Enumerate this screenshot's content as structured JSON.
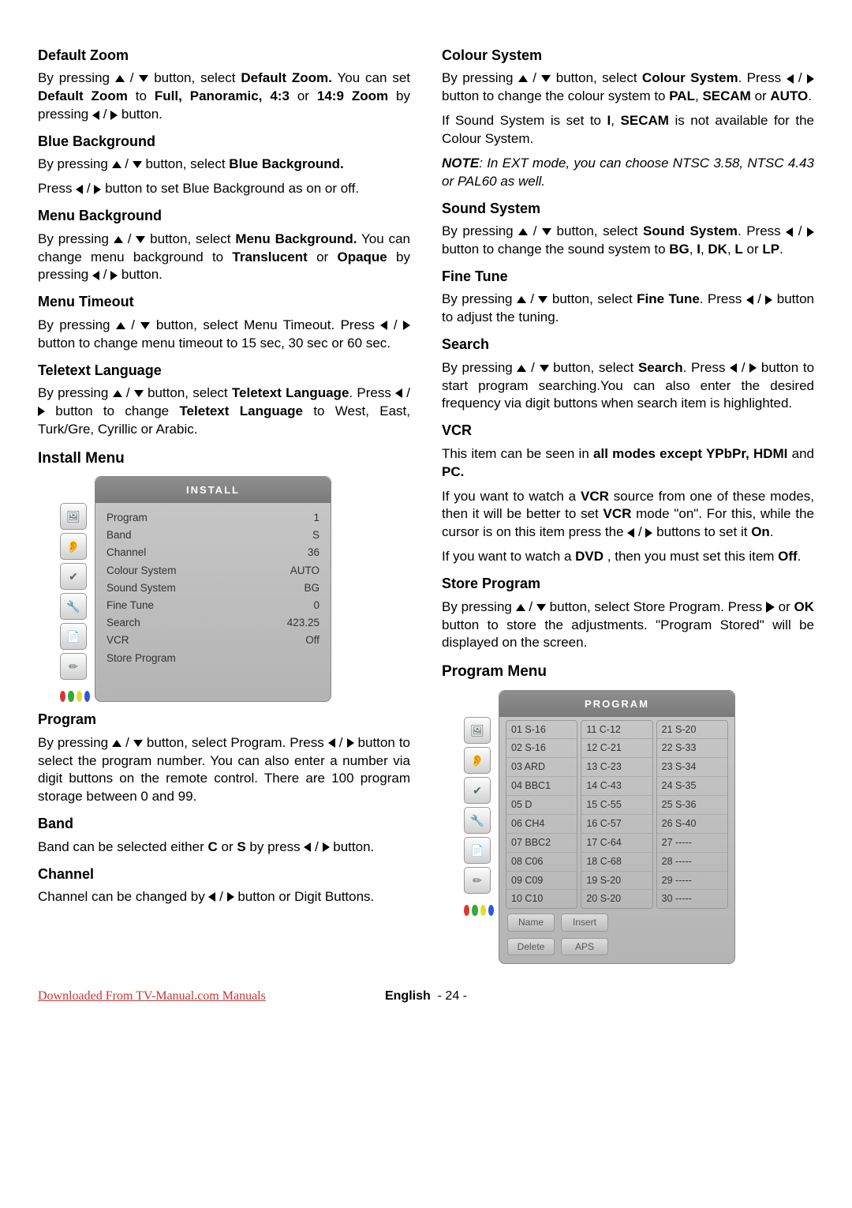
{
  "footer": {
    "download_text": "Downloaded From TV-Manual.com Manuals",
    "lang": "English",
    "page": "- 24 -"
  },
  "left": {
    "sections": [
      {
        "heading": "Default Zoom",
        "paras": [
          {
            "parts": [
              {
                "t": "By pressing "
              },
              {
                "arrow": "up"
              },
              {
                "t": " / "
              },
              {
                "arrow": "down"
              },
              {
                "t": " button, select "
              },
              {
                "t": "Default Zoom.",
                "b": true
              },
              {
                "t": " You can set "
              },
              {
                "t": "Default Zoom",
                "b": true
              },
              {
                "t": " to "
              },
              {
                "t": "Full, Panoramic, 4:3",
                "b": true
              },
              {
                "t": " or "
              },
              {
                "t": "14:9 Zoom",
                "b": true
              },
              {
                "t": " by pressing "
              },
              {
                "arrow": "left"
              },
              {
                "t": " / "
              },
              {
                "arrow": "right"
              },
              {
                "t": " button."
              }
            ]
          }
        ]
      },
      {
        "heading": "Blue Background",
        "paras": [
          {
            "parts": [
              {
                "t": "By pressing "
              },
              {
                "arrow": "up"
              },
              {
                "t": " / "
              },
              {
                "arrow": "down"
              },
              {
                "t": " button, select "
              },
              {
                "t": "Blue Background.",
                "b": true
              }
            ]
          },
          {
            "parts": [
              {
                "t": "Press "
              },
              {
                "arrow": "left"
              },
              {
                "t": " / "
              },
              {
                "arrow": "right"
              },
              {
                "t": " button  to set Blue Background as on or off."
              }
            ]
          }
        ]
      },
      {
        "heading": "Menu Background",
        "paras": [
          {
            "parts": [
              {
                "t": "By pressing "
              },
              {
                "arrow": "up"
              },
              {
                "t": " / "
              },
              {
                "arrow": "down"
              },
              {
                "t": " button, select "
              },
              {
                "t": "Menu Background.",
                "b": true
              },
              {
                "t": " You can change menu background to "
              },
              {
                "t": "Translucent",
                "b": true
              },
              {
                "t": " or "
              },
              {
                "t": "Opaque",
                "b": true
              },
              {
                "t": " by pressing "
              },
              {
                "arrow": "left"
              },
              {
                "t": " / "
              },
              {
                "arrow": "right"
              },
              {
                "t": " button."
              }
            ]
          }
        ]
      },
      {
        "heading": "Menu Timeout",
        "paras": [
          {
            "parts": [
              {
                "t": "By pressing "
              },
              {
                "arrow": "up"
              },
              {
                "t": " / "
              },
              {
                "arrow": "down"
              },
              {
                "t": "  button, select Menu Timeout. Press "
              },
              {
                "arrow": "left"
              },
              {
                "t": " / "
              },
              {
                "arrow": "right"
              },
              {
                "t": " button to change menu timeout to 15 sec, 30 sec or 60 sec."
              }
            ]
          }
        ]
      },
      {
        "heading": "Teletext Language",
        "paras": [
          {
            "parts": [
              {
                "t": "By pressing "
              },
              {
                "arrow": "up"
              },
              {
                "t": " / "
              },
              {
                "arrow": "down"
              },
              {
                "t": " button, select "
              },
              {
                "t": "Teletext Language",
                "b": true
              },
              {
                "t": ". Press "
              },
              {
                "arrow": "left"
              },
              {
                "t": " / "
              },
              {
                "arrow": "right"
              },
              {
                "t": " button to change "
              },
              {
                "t": "Teletext Language",
                "b": true
              },
              {
                "t": " to West, East, Turk/Gre, Cyrillic or Arabic."
              }
            ]
          }
        ]
      }
    ],
    "big_heading": "Install Menu",
    "install_menu": {
      "title": "INSTALL",
      "rows": [
        {
          "label": "Program",
          "value": "1"
        },
        {
          "label": "Band",
          "value": "S"
        },
        {
          "label": "Channel",
          "value": "36"
        },
        {
          "label": "Colour System",
          "value": "AUTO"
        },
        {
          "label": "Sound System",
          "value": "BG"
        },
        {
          "label": "Fine Tune",
          "value": "0"
        },
        {
          "label": "Search",
          "value": "423.25"
        },
        {
          "label": "VCR",
          "value": "Off"
        },
        {
          "label": "Store Program",
          "value": ""
        }
      ]
    },
    "after_menu": [
      {
        "heading": "Program",
        "paras": [
          {
            "parts": [
              {
                "t": "By pressing "
              },
              {
                "arrow": "up"
              },
              {
                "t": " / "
              },
              {
                "arrow": "down"
              },
              {
                "t": "  button, select Program. Press "
              },
              {
                "arrow": "left"
              },
              {
                "t": " / "
              },
              {
                "arrow": "right"
              },
              {
                "t": " button to select the program number. You can also enter a number via digit buttons on the remote control. There are 100 program storage between 0 and 99."
              }
            ]
          }
        ]
      },
      {
        "heading": "Band",
        "paras": [
          {
            "parts": [
              {
                "t": "Band can be selected either "
              },
              {
                "t": "C",
                "b": true
              },
              {
                "t": " or "
              },
              {
                "t": "S",
                "b": true
              },
              {
                "t": " by press "
              },
              {
                "arrow": "left"
              },
              {
                "t": " / "
              },
              {
                "arrow": "right"
              },
              {
                "t": " button."
              }
            ]
          }
        ]
      },
      {
        "heading": "Channel",
        "paras": [
          {
            "parts": [
              {
                "t": "Channel can be changed by "
              },
              {
                "arrow": "left"
              },
              {
                "t": " / "
              },
              {
                "arrow": "right"
              },
              {
                "t": " button or Digit Buttons."
              }
            ]
          }
        ]
      }
    ]
  },
  "right": {
    "sections": [
      {
        "heading": "Colour System",
        "paras": [
          {
            "parts": [
              {
                "t": "By pressing "
              },
              {
                "arrow": "up"
              },
              {
                "t": " / "
              },
              {
                "arrow": "down"
              },
              {
                "t": " button, select "
              },
              {
                "t": "Colour System",
                "b": true
              },
              {
                "t": ". Press "
              },
              {
                "arrow": "left"
              },
              {
                "t": " / "
              },
              {
                "arrow": "right"
              },
              {
                "t": " button to change the colour system to "
              },
              {
                "t": "PAL",
                "b": true
              },
              {
                "t": ", "
              },
              {
                "t": "SECAM",
                "b": true
              },
              {
                "t": " or "
              },
              {
                "t": "AUTO",
                "b": true
              },
              {
                "t": "."
              }
            ]
          },
          {
            "parts": [
              {
                "t": "If Sound  System is set to "
              },
              {
                "t": "I",
                "b": true
              },
              {
                "t": ", "
              },
              {
                "t": "SECAM",
                "b": true
              },
              {
                "t": " is not available for the Colour System."
              }
            ]
          },
          {
            "parts": [
              {
                "t": "NOTE",
                "b": true,
                "i": true
              },
              {
                "t": ": In EXT mode, you can choose NTSC 3.58, NTSC 4.43 or PAL60 as well.",
                "i": true
              }
            ]
          }
        ]
      },
      {
        "heading": "Sound System",
        "paras": [
          {
            "parts": [
              {
                "t": "By pressing "
              },
              {
                "arrow": "up"
              },
              {
                "t": " / "
              },
              {
                "arrow": "down"
              },
              {
                "t": " button, select "
              },
              {
                "t": "Sound System",
                "b": true
              },
              {
                "t": ". Press "
              },
              {
                "arrow": "left"
              },
              {
                "t": " / "
              },
              {
                "arrow": "right"
              },
              {
                "t": " button to change the sound system to "
              },
              {
                "t": "BG",
                "b": true
              },
              {
                "t": ", "
              },
              {
                "t": "I",
                "b": true
              },
              {
                "t": ", "
              },
              {
                "t": "DK",
                "b": true
              },
              {
                "t": ", "
              },
              {
                "t": "L",
                "b": true
              },
              {
                "t": " or "
              },
              {
                "t": "LP",
                "b": true
              },
              {
                "t": "."
              }
            ]
          }
        ]
      },
      {
        "heading": "Fine Tune",
        "paras": [
          {
            "parts": [
              {
                "t": "By pressing "
              },
              {
                "arrow": "up"
              },
              {
                "t": " / "
              },
              {
                "arrow": "down"
              },
              {
                "t": " button, select "
              },
              {
                "t": "Fine Tune",
                "b": true
              },
              {
                "t": ". Press "
              },
              {
                "arrow": "left"
              },
              {
                "t": " / "
              },
              {
                "arrow": "right"
              },
              {
                "t": " button to adjust the tuning."
              }
            ]
          }
        ]
      },
      {
        "heading": "Search",
        "paras": [
          {
            "parts": [
              {
                "t": "By pressing "
              },
              {
                "arrow": "up"
              },
              {
                "t": " / "
              },
              {
                "arrow": "down"
              },
              {
                "t": " button, select "
              },
              {
                "t": "Search",
                "b": true
              },
              {
                "t": ". Press  "
              },
              {
                "arrow": "left"
              },
              {
                "t": " / "
              },
              {
                "arrow": "right"
              },
              {
                "t": " button to start program searching.You can also enter the desired frequency via digit buttons when search item is highlighted."
              }
            ]
          }
        ]
      },
      {
        "heading": "VCR",
        "paras": [
          {
            "parts": [
              {
                "t": "This item can be seen in "
              },
              {
                "t": "all modes except  YPbPr, HDMI",
                "b": true
              },
              {
                "t": " and "
              },
              {
                "t": "PC.",
                "b": true
              }
            ]
          },
          {
            "parts": [
              {
                "t": "If you want to watch a "
              },
              {
                "t": "VCR",
                "b": true
              },
              {
                "t": " source from one of these modes, then  it will be better to set "
              },
              {
                "t": "VCR",
                "b": true
              },
              {
                "t": " mode \"on\". For this, while the cursor is on this item press the "
              },
              {
                "arrow": "left"
              },
              {
                "t": " / "
              },
              {
                "arrow": "right"
              },
              {
                "t": " buttons to set it "
              },
              {
                "t": "On",
                "b": true
              },
              {
                "t": "."
              }
            ]
          },
          {
            "parts": [
              {
                "t": "If you want to watch a "
              },
              {
                "t": "DVD",
                "b": true
              },
              {
                "t": " , then you must set this item "
              },
              {
                "t": "Off",
                "b": true
              },
              {
                "t": "."
              }
            ]
          }
        ]
      },
      {
        "heading": "Store Program",
        "paras": [
          {
            "parts": [
              {
                "t": "By pressing "
              },
              {
                "arrow": "up"
              },
              {
                "t": " / "
              },
              {
                "arrow": "down"
              },
              {
                "t": "  button, select Store Program. Press "
              },
              {
                "arrow": "play"
              },
              {
                "t": " or "
              },
              {
                "t": "OK",
                "b": true
              },
              {
                "t": " button to store the adjustments. \"Program Stored\" will be displayed on the screen."
              }
            ]
          }
        ]
      }
    ],
    "big_heading": "Program Menu",
    "program_menu": {
      "title": "PROGRAM",
      "columns": [
        [
          "01 S-16",
          "02 S-16",
          "03 ARD",
          "04 BBC1",
          "05 D",
          "06 CH4",
          "07 BBC2",
          "08 C06",
          "09 C09",
          "10 C10"
        ],
        [
          "11 C-12",
          "12 C-21",
          "13 C-23",
          "14 C-43",
          "15 C-55",
          "16 C-57",
          "17 C-64",
          "18 C-68",
          "19 S-20",
          "20 S-20"
        ],
        [
          "21 S-20",
          "22 S-33",
          "23 S-34",
          "24 S-35",
          "25 S-36",
          "26 S-40",
          "27 -----",
          "28 -----",
          "29 -----",
          "30 -----"
        ]
      ],
      "footer_buttons": [
        "Name",
        "Insert",
        "Delete",
        "APS"
      ]
    }
  },
  "icons": [
    "🖼",
    "👂",
    "✔",
    "🔧",
    "📄",
    "✏"
  ]
}
